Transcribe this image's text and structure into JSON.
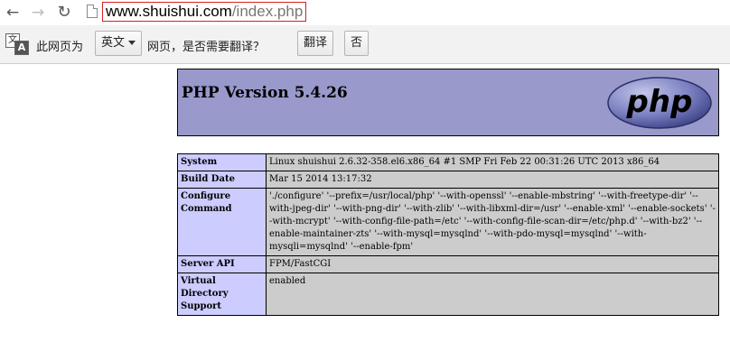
{
  "browser": {
    "url_host": "www.shuishui.com",
    "url_path": "/index.php"
  },
  "infobar": {
    "text_prefix": "此网页为",
    "language": "英文",
    "text_question": "网页，是否需要翻译？",
    "translate_button": "翻译",
    "no_button": "否"
  },
  "php": {
    "title": "PHP Version 5.4.26",
    "logo_text": "php",
    "rows": [
      {
        "key": "System",
        "value": "Linux shuishui 2.6.32-358.el6.x86_64 #1 SMP Fri Feb 22 00:31:26 UTC 2013 x86_64"
      },
      {
        "key": "Build Date",
        "value": "Mar 15 2014 13:17:32"
      },
      {
        "key": "Configure Command",
        "value": "'./configure' '--prefix=/usr/local/php' '--with-openssl' '--enable-mbstring' '--with-freetype-dir' '--with-jpeg-dir' '--with-png-dir' '--with-zlib' '--with-libxml-dir=/usr' '--enable-xml' '--enable-sockets' '--with-mcrypt' '--with-config-file-path=/etc' '--with-config-file-scan-dir=/etc/php.d' '--with-bz2' '--enable-maintainer-zts' '--with-mysql=mysqlnd' '--with-pdo-mysql=mysqlnd' '--with-mysqli=mysqlnd' '--enable-fpm'"
      },
      {
        "key": "Server API",
        "value": "FPM/FastCGI"
      },
      {
        "key": "Virtual Directory Support",
        "value": "enabled"
      }
    ]
  },
  "colors": {
    "header_bg": "#9999cc",
    "key_cell_bg": "#ccccff",
    "value_cell_bg": "#cccccc",
    "url_highlight_border": "#d2231f"
  }
}
